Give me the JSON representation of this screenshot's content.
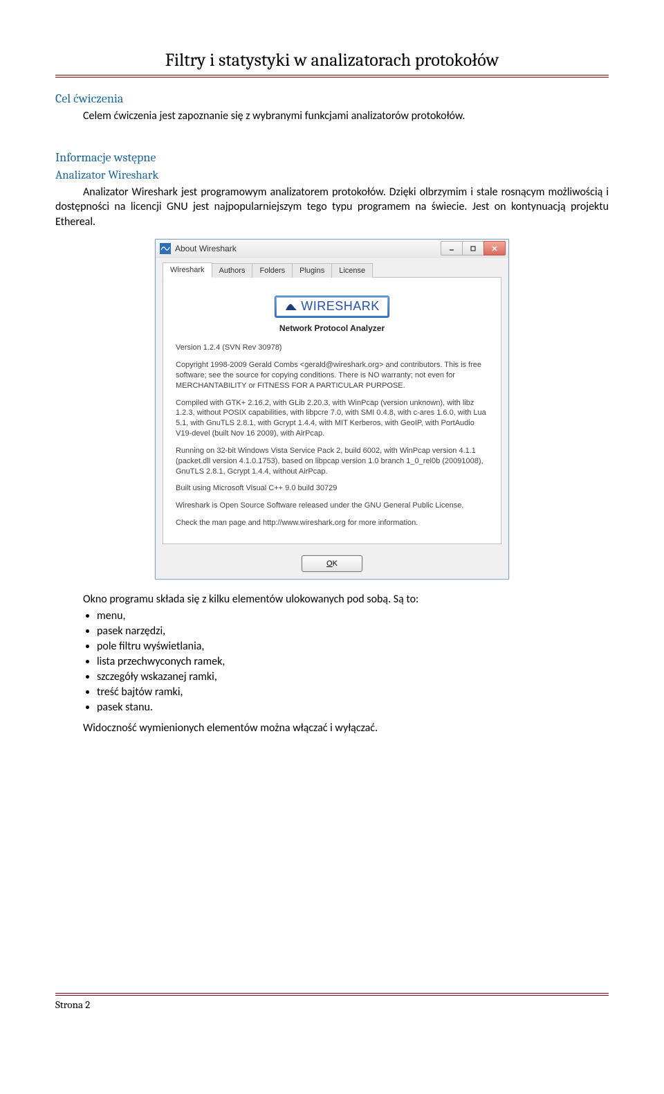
{
  "header": {
    "title": "Filtry i statystyki w analizatorach protokołów"
  },
  "sections": {
    "cel": {
      "heading": "Cel ćwiczenia",
      "text": "Celem ćwiczenia jest zapoznanie się z wybranymi funkcjami analizatorów protokołów."
    },
    "info": {
      "heading": "Informacje wstępne",
      "sub1": "Analizator Wireshark",
      "para1": "Analizator Wireshark jest programowym analizatorem protokołów. Dzięki olbrzymim i stale rosnącym możliwością i dostępności na licencji GNU jest najpopularniejszym tego typu programem na świecie. Jest on kontynuacją projektu Ethereal.",
      "afterImg": "Okno programu składa się z kilku elementów ulokowanych pod sobą. Są to:",
      "bullets": [
        "menu,",
        "pasek narzędzi,",
        "pole filtru wyświetlania,",
        "lista przechwyconych ramek,",
        "szczegóły wskazanej ramki,",
        "treść bajtów ramki,",
        "pasek stanu."
      ],
      "closing": "Widoczność wymienionych elementów można włączać i wyłączać."
    }
  },
  "about": {
    "window_title": "About Wireshark",
    "tabs": [
      "Wireshark",
      "Authors",
      "Folders",
      "Plugins",
      "License"
    ],
    "logo_text": "WIRESHARK",
    "subtitle": "Network Protocol Analyzer",
    "version": "Version 1.2.4 (SVN Rev 30978)",
    "p_copyright": "Copyright 1998-2009 Gerald Combs <gerald@wireshark.org> and contributors. This is free software; see the source for copying conditions. There is NO warranty; not even for MERCHANTABILITY or FITNESS FOR A PARTICULAR PURPOSE.",
    "p_compiled": "Compiled with GTK+ 2.16.2, with GLib 2.20.3, with WinPcap (version unknown), with libz 1.2.3, without POSIX capabilities, with libpcre 7.0, with SMI 0.4.8, with c-ares 1.6.0, with Lua 5.1, with GnuTLS 2.8.1, with Gcrypt 1.4.4, with MIT Kerberos, with GeoIP, with PortAudio V19-devel (built Nov 16 2009), with AirPcap.",
    "p_running": "Running on 32-bit Windows Vista Service Pack 2, build 6002, with WinPcap version 4.1.1 (packet.dll version 4.1.0.1753), based on libpcap version 1.0 branch 1_0_rel0b (20091008), GnuTLS 2.8.1, Gcrypt 1.4.4, without AirPcap.",
    "p_built": "Built using Microsoft Visual C++ 9.0 build 30729",
    "p_oss": "Wireshark is Open Source Software released under the GNU General Public License.",
    "p_check": "Check the man page and http://www.wireshark.org for more information.",
    "ok_prefix": "O",
    "ok_suffix": "K"
  },
  "footer": {
    "page": "Strona 2"
  }
}
